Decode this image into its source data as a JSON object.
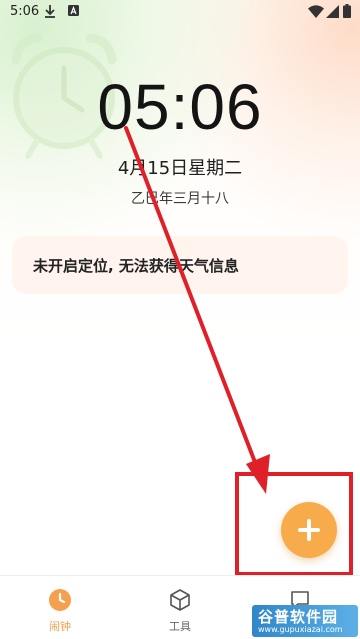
{
  "status_bar": {
    "time": "5:06",
    "icons": [
      "download-icon",
      "a-icon",
      "wifi-icon",
      "signal-icon",
      "battery-icon"
    ]
  },
  "clock": {
    "time": "05:06",
    "date": "4月15日星期二",
    "lunar": "乙巳年三月十八"
  },
  "weather": {
    "message": "未开启定位, 无法获得天气信息"
  },
  "fab": {
    "icon": "plus-icon",
    "color": "#f8ab4a"
  },
  "bottom_nav": {
    "items": [
      {
        "label": "闹钟",
        "icon": "clock-icon",
        "active": true
      },
      {
        "label": "工具",
        "icon": "box-icon",
        "active": false
      },
      {
        "label": "",
        "icon": "chat-icon",
        "active": false
      }
    ]
  },
  "watermark": {
    "title": "谷普软件园",
    "url": "www.gupuxiazai.com"
  },
  "colors": {
    "accent": "#f5a04c",
    "annotation": "#e02028"
  }
}
